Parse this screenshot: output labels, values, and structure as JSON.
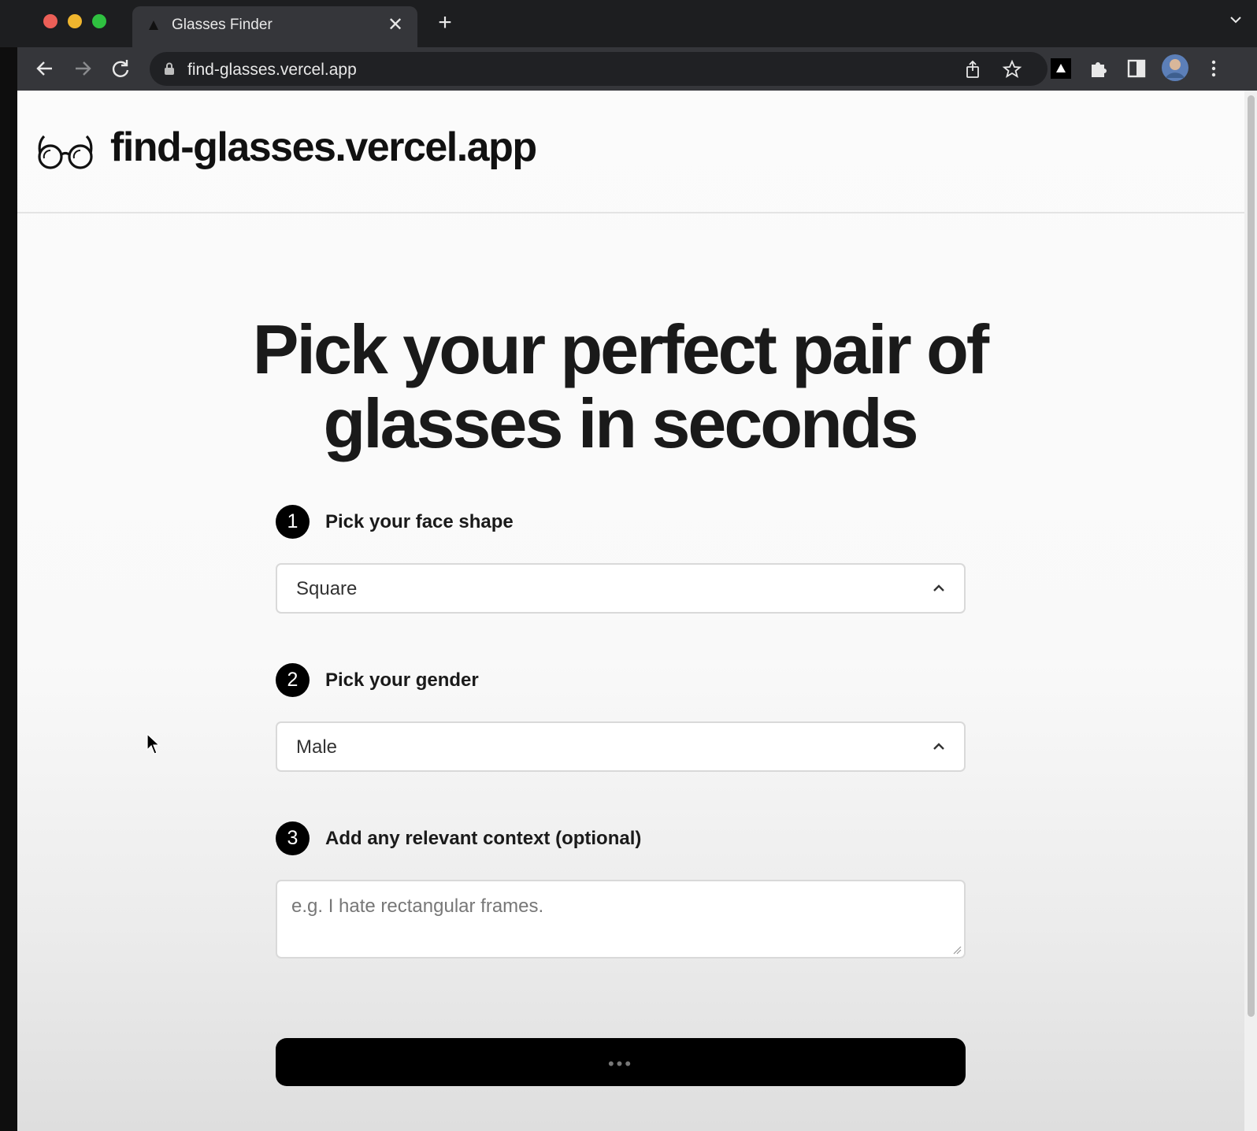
{
  "browser": {
    "tab_title": "Glasses Finder",
    "tab_close": "✕",
    "new_tab": "+",
    "url": "find-glasses.vercel.app"
  },
  "site": {
    "name": "find-glasses.vercel.app"
  },
  "hero": {
    "line1": "Pick your perfect pair of",
    "line2": "glasses in seconds"
  },
  "steps": [
    {
      "number": "1",
      "label": "Pick your face shape",
      "selected": "Square"
    },
    {
      "number": "2",
      "label": "Pick your gender",
      "selected": "Male"
    },
    {
      "number": "3",
      "label": "Add any relevant context (optional)",
      "placeholder": "e.g. I hate rectangular frames."
    }
  ],
  "submit": {
    "loading_indicator": "•••"
  },
  "colors": {
    "accent": "#000000",
    "chrome_dark": "#35363a",
    "page_bg": "#fbfbfb"
  }
}
